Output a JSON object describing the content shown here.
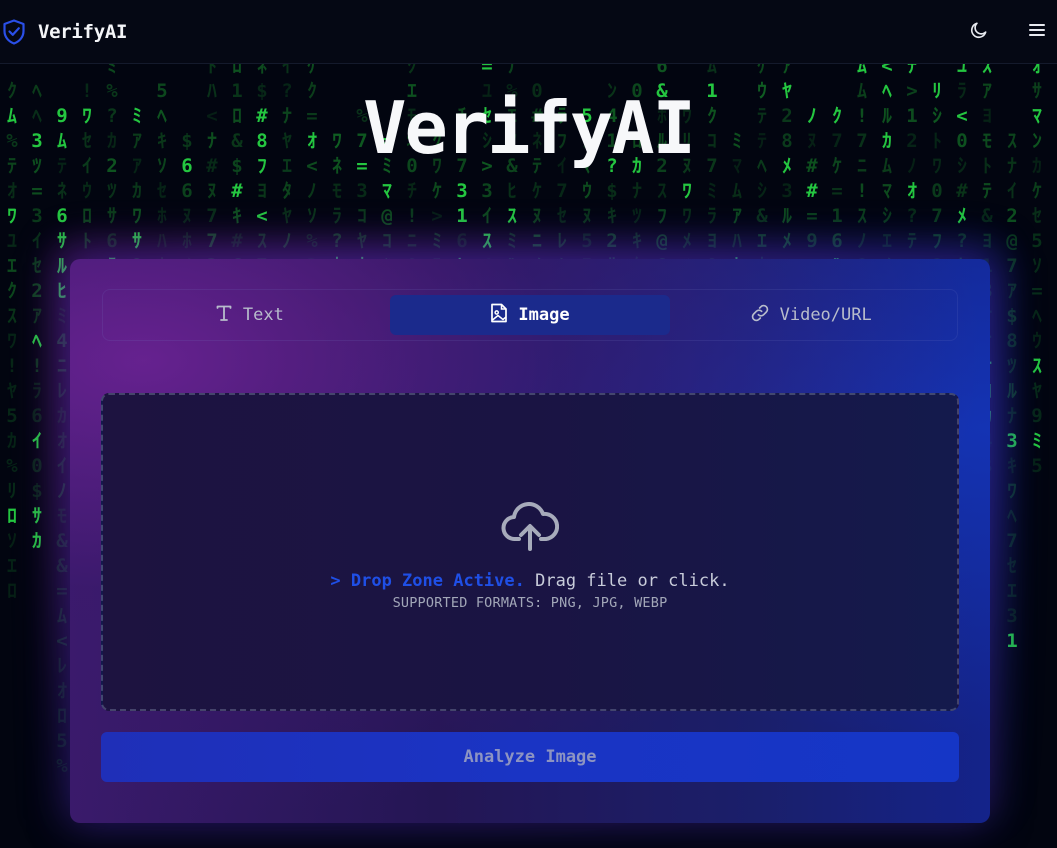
{
  "header": {
    "brand_name": "VerifyAI",
    "logo_icon": "shield-check-icon",
    "theme_icon": "moon-icon",
    "menu_icon": "hamburger-menu-icon"
  },
  "hero": {
    "title": "VerifyAI"
  },
  "tabs": [
    {
      "label": "Text",
      "icon": "text-icon",
      "active": false
    },
    {
      "label": "Image",
      "icon": "image-file-icon",
      "active": true
    },
    {
      "label": "Video/URL",
      "icon": "link-icon",
      "active": false
    }
  ],
  "dropzone": {
    "icon": "cloud-upload-icon",
    "active_text": "> Drop Zone Active.",
    "instruction": " Drag file or click.",
    "formats": "SUPPORTED FORMATS: PNG, JPG, WEBP"
  },
  "analyze_button": {
    "label": "Analyze Image"
  },
  "colors": {
    "accent_blue": "#1f4fe6",
    "matrix_green": "#1fc23a",
    "tab_active_bg": "#1b2a8c",
    "background": "#020510"
  }
}
